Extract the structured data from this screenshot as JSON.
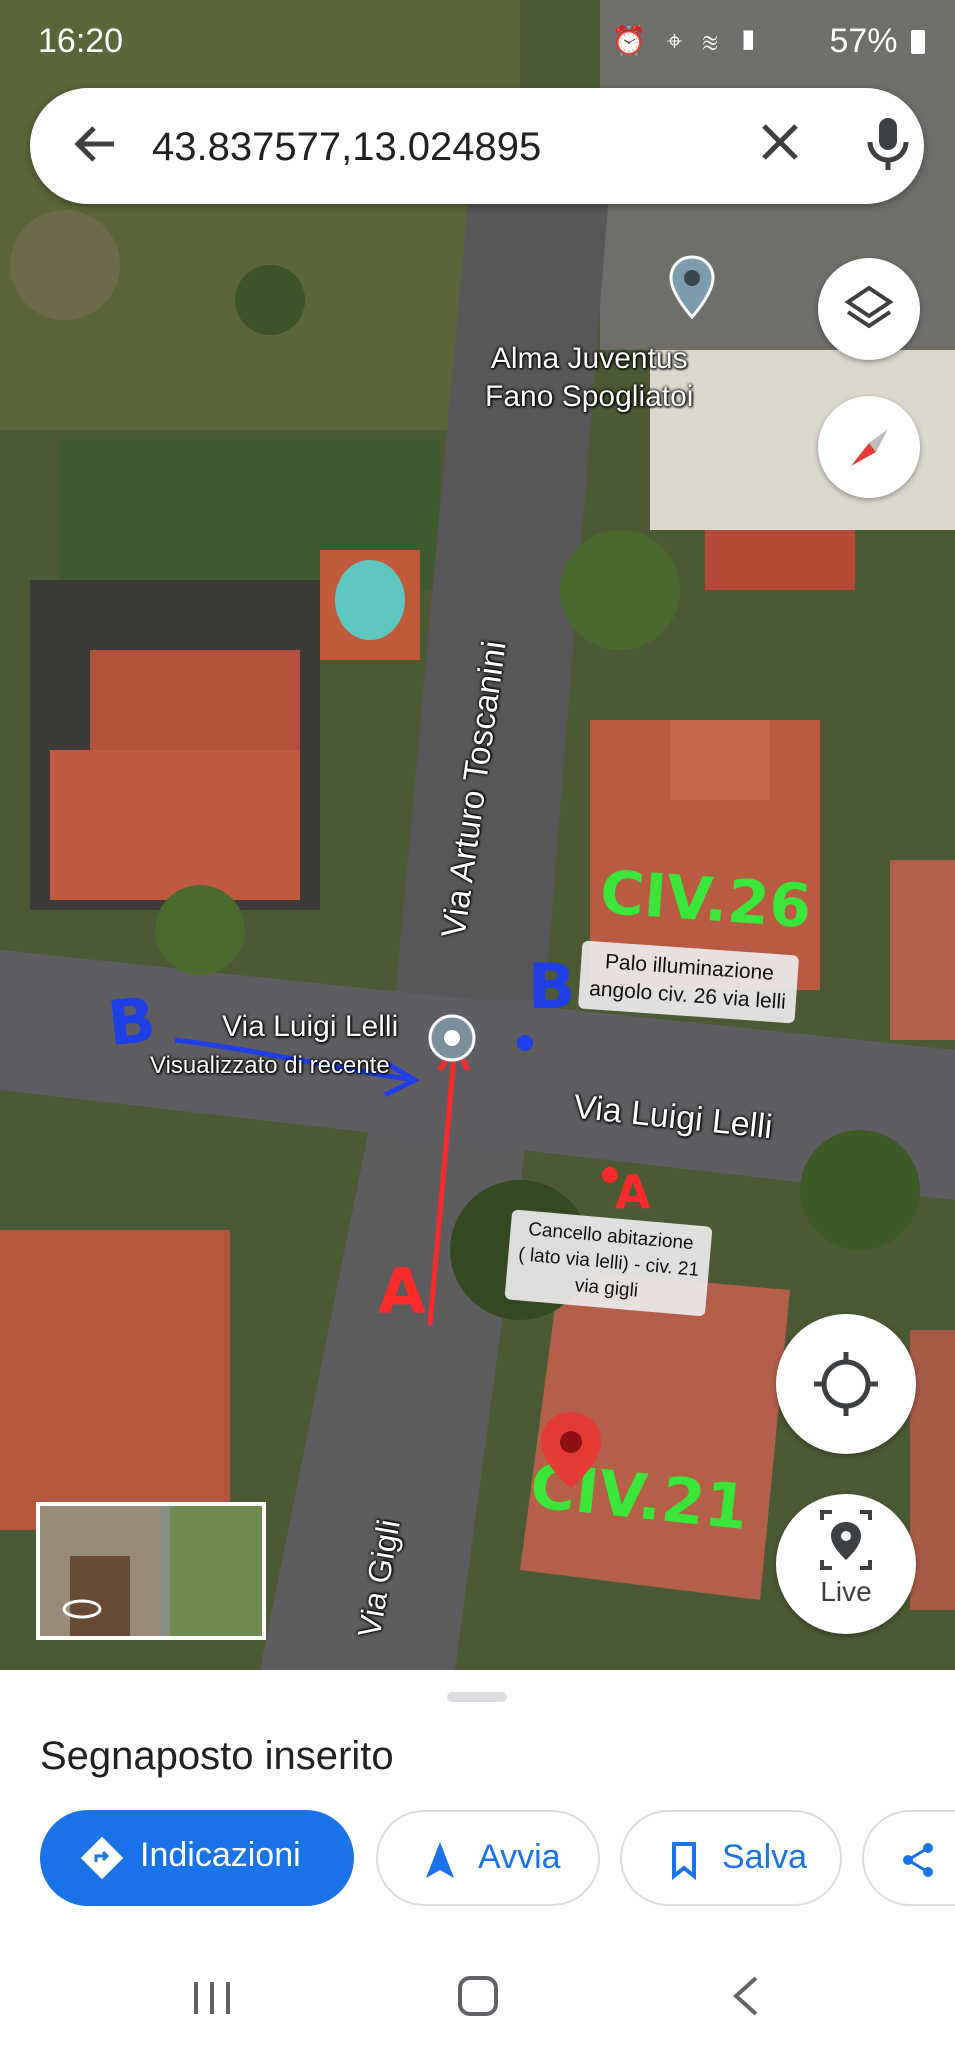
{
  "status_bar": {
    "time": "16:20",
    "battery": "57%"
  },
  "search": {
    "query": "43.837577,13.024895"
  },
  "map": {
    "places": {
      "alma_line1": "Alma Juventus",
      "alma_line2": "Fano Spogliatoi",
      "via_toscanini": "Via Arturo Toscanini",
      "via_lelli_pin": "Via Luigi Lelli",
      "recently_viewed": "Visualizzato di recente",
      "via_lelli_road": "Via Luigi Lelli",
      "via_gigli": "Via Gigli"
    },
    "annotations": {
      "civ26": "CIV.26",
      "civ21": "CIV.21",
      "b_left": "B",
      "b_right": "B",
      "a_left": "A",
      "a_right": "A",
      "palo_note": [
        "Palo illuminazione",
        "angolo civ. 26 via lelli"
      ],
      "cancello_note": [
        "Cancello abitazione",
        "( lato via lelli) - civ. 21",
        "via gigli"
      ]
    }
  },
  "controls": {
    "live_label": "Live"
  },
  "sheet": {
    "title": "Segnaposto inserito",
    "actions": [
      {
        "label": "Indicazioni",
        "icon": "directions-icon"
      },
      {
        "label": "Avvia",
        "icon": "navigation-arrow-icon"
      },
      {
        "label": "Salva",
        "icon": "bookmark-icon"
      },
      {
        "label": "",
        "icon": "share-icon"
      }
    ]
  },
  "colors": {
    "accent": "#1a73e8",
    "red_marker": "#e53935",
    "green_annotation": "#39e639",
    "blue_annotation": "#1e3ee6"
  }
}
